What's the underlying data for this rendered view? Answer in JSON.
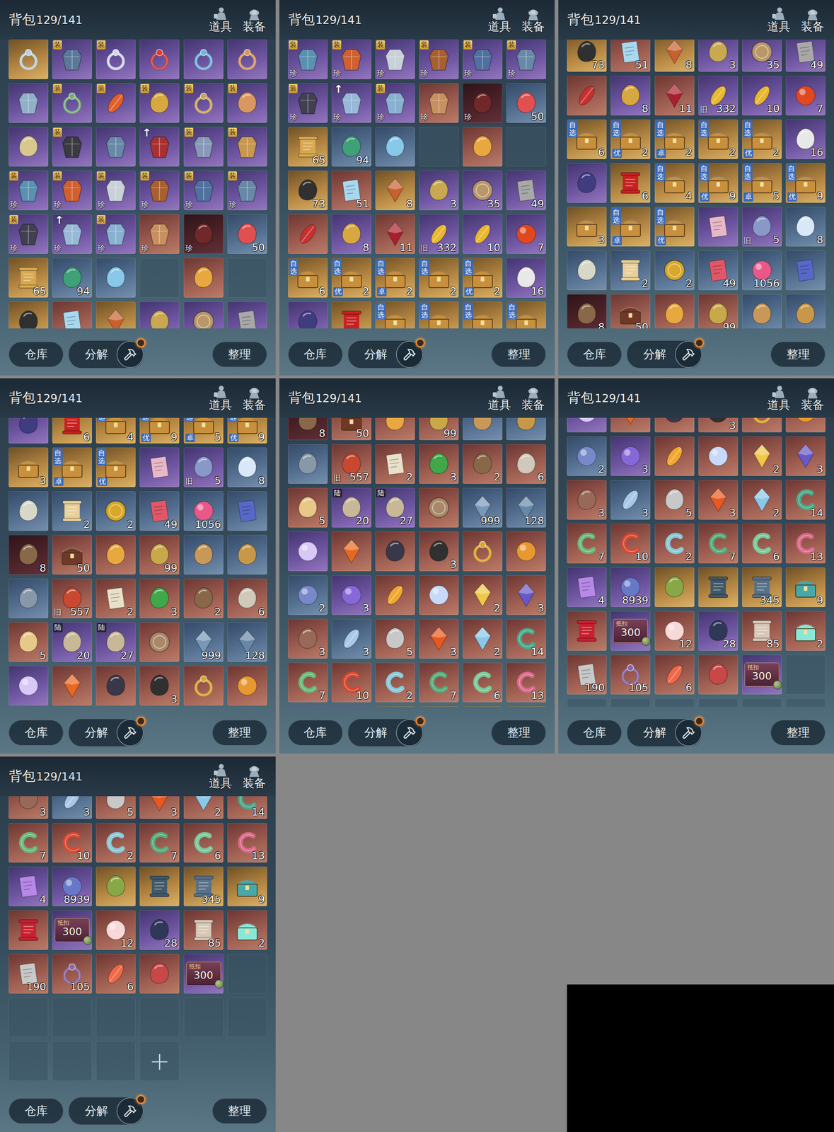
{
  "inventory": {
    "title": "背包",
    "count": "129/141",
    "tabs": [
      {
        "label": "道具"
      },
      {
        "label": "装备"
      }
    ],
    "buttons": [
      {
        "label": "仓库",
        "kind": "plain",
        "alert": false
      },
      {
        "label": "分解",
        "kind": "tool",
        "alert": true
      },
      {
        "label": "整理",
        "kind": "plain",
        "alert": false
      }
    ],
    "badge_kinds": {
      "装": "gold",
      "自选": "stack",
      "陆": "dark",
      "↑": "arrow",
      "抵扣": "note",
      "珍": "plain",
      "旧": "plain",
      "优": "blue",
      "卓": "blue"
    },
    "rows": [
      [
        {
          "kind": "ring",
          "rarity": "gold",
          "color": "#b8d0e0"
        },
        {
          "kind": "gear",
          "rarity": "purple",
          "color": "#5a7898",
          "mark": "装"
        },
        {
          "kind": "ring",
          "rarity": "purple",
          "color": "#d0d8e8",
          "mark": "装"
        },
        {
          "kind": "ring",
          "rarity": "purple",
          "color": "#d04038"
        },
        {
          "kind": "ring",
          "rarity": "purple",
          "color": "#70b8d8"
        },
        {
          "kind": "ring",
          "rarity": "purple",
          "color": "#d89858"
        }
      ],
      [
        {
          "kind": "gear",
          "rarity": "purple",
          "color": "#90b0c8"
        },
        {
          "kind": "ring",
          "rarity": "purple",
          "color": "#78b078",
          "mark": "装"
        },
        {
          "kind": "leaf",
          "rarity": "purple",
          "color": "#e06028",
          "mark": "装"
        },
        {
          "kind": "misc",
          "rarity": "purple",
          "color": "#d8a840",
          "mark": "装"
        },
        {
          "kind": "ring",
          "rarity": "purple",
          "color": "#c8a860",
          "mark": "装"
        },
        {
          "kind": "misc",
          "rarity": "purple",
          "color": "#d89860",
          "mark": "装"
        }
      ],
      [
        {
          "kind": "misc",
          "rarity": "purple",
          "color": "#d8c890"
        },
        {
          "kind": "gear",
          "rarity": "purple",
          "color": "#3a3a40",
          "mark": "装"
        },
        {
          "kind": "gear",
          "rarity": "purple",
          "color": "#6888a8"
        },
        {
          "kind": "gear",
          "rarity": "purple",
          "color": "#a83030",
          "mark": "↑"
        },
        {
          "kind": "gear",
          "rarity": "purple",
          "color": "#8898b8",
          "mark": "装"
        },
        {
          "kind": "gear",
          "rarity": "purple",
          "color": "#c89850",
          "mark": "装"
        }
      ],
      [
        {
          "kind": "gear",
          "rarity": "purple",
          "color": "#5a90b0",
          "mark": "装",
          "sub": "珍"
        },
        {
          "kind": "gear",
          "rarity": "purple",
          "color": "#d06030",
          "mark": "装",
          "sub": "珍"
        },
        {
          "kind": "gear",
          "rarity": "purple",
          "color": "#c8d0d8",
          "mark": "装",
          "sub": "珍"
        },
        {
          "kind": "gear",
          "rarity": "purple",
          "color": "#a86030",
          "mark": "装",
          "sub": "珍"
        },
        {
          "kind": "gear",
          "rarity": "purple",
          "color": "#5070a0",
          "mark": "装",
          "sub": "珍"
        },
        {
          "kind": "gear",
          "rarity": "purple",
          "color": "#6888a8",
          "mark": "装",
          "sub": "珍"
        }
      ],
      [
        {
          "kind": "gear",
          "rarity": "purple",
          "color": "#404050",
          "mark": "装",
          "sub": "珍"
        },
        {
          "kind": "gear",
          "rarity": "purple",
          "color": "#98b8d8",
          "mark": "↑",
          "sub": "珍"
        },
        {
          "kind": "gear",
          "rarity": "purple",
          "color": "#88b0d0",
          "mark": "装",
          "sub": "珍"
        },
        {
          "kind": "gear",
          "rarity": "red",
          "color": "#c89060",
          "sub": "珍"
        },
        {
          "kind": "misc",
          "rarity": "dark",
          "color": "#702828",
          "sub": "珍"
        },
        {
          "kind": "misc",
          "rarity": "blue",
          "color": "#e05050",
          "count": "50"
        }
      ],
      [
        {
          "kind": "scroll",
          "rarity": "gold",
          "color": "#d8a850",
          "count": "65"
        },
        {
          "kind": "misc",
          "rarity": "blue",
          "color": "#40a078",
          "count": "94"
        },
        {
          "kind": "misc",
          "rarity": "blue",
          "color": "#88c8e8"
        },
        {
          "kind": "empty"
        },
        {
          "kind": "misc",
          "rarity": "red",
          "color": "#e8a840"
        },
        {
          "kind": "empty"
        }
      ],
      [
        {
          "kind": "misc",
          "rarity": "gold",
          "color": "#303030",
          "count": "73"
        },
        {
          "kind": "paper",
          "rarity": "red",
          "color": "#a8d8f0",
          "count": "51"
        },
        {
          "kind": "crystal",
          "rarity": "gold",
          "color": "#c86030",
          "count": "8"
        },
        {
          "kind": "misc",
          "rarity": "purple",
          "color": "#c8a850",
          "count": "3"
        },
        {
          "kind": "coin",
          "rarity": "purple",
          "color": "#b89868",
          "count": "35"
        },
        {
          "kind": "paper",
          "rarity": "purple",
          "color": "#a8a8a8",
          "count": "49"
        }
      ],
      [
        {
          "kind": "leaf",
          "rarity": "red",
          "color": "#c83030"
        },
        {
          "kind": "misc",
          "rarity": "purple",
          "color": "#d8a840",
          "count": "8"
        },
        {
          "kind": "crystal",
          "rarity": "red",
          "color": "#a82030",
          "count": "11"
        },
        {
          "kind": "leaf",
          "rarity": "purple",
          "color": "#e8b830",
          "count": "332",
          "sub": "旧"
        },
        {
          "kind": "leaf",
          "rarity": "purple",
          "color": "#e8b830",
          "count": "10"
        },
        {
          "kind": "orb",
          "rarity": "purple",
          "color": "#e04820",
          "count": "7"
        }
      ],
      [
        {
          "kind": "chest",
          "rarity": "gold",
          "color": "#c8903c",
          "count": "6",
          "mark": "自选"
        },
        {
          "kind": "chest",
          "rarity": "gold",
          "color": "#c8903c",
          "count": "2",
          "mark": "自选",
          "sub": "优"
        },
        {
          "kind": "chest",
          "rarity": "gold",
          "color": "#c8903c",
          "count": "2",
          "mark": "自选",
          "sub": "卓"
        },
        {
          "kind": "chest",
          "rarity": "gold",
          "color": "#c8903c",
          "count": "2",
          "mark": "自选"
        },
        {
          "kind": "chest",
          "rarity": "gold",
          "color": "#c8903c",
          "count": "2",
          "mark": "自选",
          "sub": "优"
        },
        {
          "kind": "misc",
          "rarity": "purple",
          "color": "#e8e8e8",
          "count": "16"
        }
      ],
      [
        {
          "kind": "misc",
          "rarity": "purple",
          "color": "#403c80"
        },
        {
          "kind": "scroll",
          "rarity": "gold",
          "color": "#c82020",
          "count": "6"
        },
        {
          "kind": "chest",
          "rarity": "gold",
          "color": "#c8903c",
          "count": "4",
          "mark": "自选"
        },
        {
          "kind": "chest",
          "rarity": "gold",
          "color": "#c8903c",
          "count": "9",
          "mark": "自选",
          "sub": "优"
        },
        {
          "kind": "chest",
          "rarity": "gold",
          "color": "#c8903c",
          "count": "5",
          "mark": "自选",
          "sub": "卓"
        },
        {
          "kind": "chest",
          "rarity": "gold",
          "color": "#c8903c",
          "count": "9",
          "mark": "自选",
          "sub": "优"
        }
      ],
      [
        {
          "kind": "chest",
          "rarity": "gold",
          "color": "#c8903c",
          "count": "3"
        },
        {
          "kind": "chest",
          "rarity": "gold",
          "color": "#c8903c",
          "mark": "自选",
          "sub": "卓"
        },
        {
          "kind": "chest",
          "rarity": "gold",
          "color": "#c8903c",
          "mark": "自选",
          "sub": "优"
        },
        {
          "kind": "paper",
          "rarity": "purple",
          "color": "#e8b8c8"
        },
        {
          "kind": "misc",
          "rarity": "purple",
          "color": "#8898c8",
          "count": "5",
          "sub": "旧"
        },
        {
          "kind": "misc",
          "rarity": "blue",
          "color": "#d8e8f8",
          "count": "8"
        }
      ],
      [
        {
          "kind": "misc",
          "rarity": "blue",
          "color": "#d8d8c8"
        },
        {
          "kind": "scroll",
          "rarity": "blue",
          "color": "#e8d098",
          "count": "2"
        },
        {
          "kind": "coin",
          "rarity": "blue",
          "color": "#d8a828",
          "count": "2"
        },
        {
          "kind": "paper",
          "rarity": "blue",
          "color": "#e05868",
          "count": "49"
        },
        {
          "kind": "orb",
          "rarity": "blue",
          "color": "#e85888",
          "count": "1056"
        },
        {
          "kind": "paper",
          "rarity": "blue",
          "color": "#5868c8"
        }
      ],
      [
        {
          "kind": "misc",
          "rarity": "dark",
          "color": "#886848",
          "count": "8"
        },
        {
          "kind": "chest",
          "rarity": "red",
          "color": "#703828",
          "count": "50"
        },
        {
          "kind": "misc",
          "rarity": "red",
          "color": "#e8a840"
        },
        {
          "kind": "misc",
          "rarity": "red",
          "color": "#c8a848",
          "count": "99"
        },
        {
          "kind": "misc",
          "rarity": "blue",
          "color": "#c89858"
        },
        {
          "kind": "misc",
          "rarity": "blue",
          "color": "#c89848"
        }
      ],
      [
        {
          "kind": "misc",
          "rarity": "blue",
          "color": "#8898a8"
        },
        {
          "kind": "misc",
          "rarity": "red",
          "color": "#c84830",
          "count": "557",
          "sub": "旧"
        },
        {
          "kind": "paper",
          "rarity": "red",
          "color": "#e8e0c8",
          "count": "2"
        },
        {
          "kind": "misc",
          "rarity": "red",
          "color": "#40a848",
          "count": "3"
        },
        {
          "kind": "misc",
          "rarity": "red",
          "color": "#886848",
          "count": "2"
        },
        {
          "kind": "misc",
          "rarity": "red",
          "color": "#d0c8b8",
          "count": "6"
        }
      ],
      [
        {
          "kind": "misc",
          "rarity": "red",
          "color": "#e8c888",
          "count": "5"
        },
        {
          "kind": "misc",
          "rarity": "purple",
          "color": "#c8b898",
          "count": "20",
          "mark": "陆"
        },
        {
          "kind": "misc",
          "rarity": "purple",
          "color": "#c8b898",
          "count": "27",
          "mark": "陆"
        },
        {
          "kind": "coin",
          "rarity": "red",
          "color": "#a88868"
        },
        {
          "kind": "crystal",
          "rarity": "blue",
          "color": "#7898b8",
          "count": "999"
        },
        {
          "kind": "crystal",
          "rarity": "blue",
          "color": "#6888a8",
          "count": "128"
        }
      ],
      [
        {
          "kind": "orb",
          "rarity": "purple",
          "color": "#d8c8f8"
        },
        {
          "kind": "crystal",
          "rarity": "red",
          "color": "#e86820"
        },
        {
          "kind": "misc",
          "rarity": "red",
          "color": "#383848"
        },
        {
          "kind": "misc",
          "rarity": "red",
          "color": "#303030",
          "count": "3"
        },
        {
          "kind": "ring",
          "rarity": "red",
          "color": "#d8a830"
        },
        {
          "kind": "orb",
          "rarity": "red",
          "color": "#e89830"
        }
      ],
      [
        {
          "kind": "orb",
          "rarity": "blue",
          "color": "#7888c8",
          "count": "2"
        },
        {
          "kind": "orb",
          "rarity": "purple",
          "color": "#8868d8",
          "count": "3"
        },
        {
          "kind": "leaf",
          "rarity": "red",
          "color": "#f0a830"
        },
        {
          "kind": "orb",
          "rarity": "red",
          "color": "#c8d8f8"
        },
        {
          "kind": "crystal",
          "rarity": "red",
          "color": "#f0c848",
          "count": "2"
        },
        {
          "kind": "crystal",
          "rarity": "red",
          "color": "#6858c8",
          "count": "3"
        }
      ],
      [
        {
          "kind": "misc",
          "rarity": "red",
          "color": "#986858",
          "count": "3"
        },
        {
          "kind": "leaf",
          "rarity": "blue",
          "color": "#a8c8e8",
          "count": "3"
        },
        {
          "kind": "misc",
          "rarity": "red",
          "color": "#c8c8c8",
          "count": "5"
        },
        {
          "kind": "crystal",
          "rarity": "red",
          "color": "#e85820",
          "count": "3"
        },
        {
          "kind": "crystal",
          "rarity": "red",
          "color": "#88c8e8",
          "count": "2"
        },
        {
          "kind": "jade",
          "rarity": "red",
          "color": "#48a888",
          "count": "14"
        }
      ],
      [
        {
          "kind": "jade",
          "rarity": "red",
          "color": "#68b878",
          "count": "7"
        },
        {
          "kind": "jade",
          "rarity": "red",
          "color": "#d84830",
          "count": "10"
        },
        {
          "kind": "jade",
          "rarity": "red",
          "color": "#88c8d8",
          "count": "2"
        },
        {
          "kind": "jade",
          "rarity": "red",
          "color": "#58a878",
          "count": "7"
        },
        {
          "kind": "jade",
          "rarity": "red",
          "color": "#78c898",
          "count": "6"
        },
        {
          "kind": "jade",
          "rarity": "red",
          "color": "#d86888",
          "count": "13"
        }
      ],
      [
        {
          "kind": "paper",
          "rarity": "purple",
          "color": "#b888e8",
          "count": "4"
        },
        {
          "kind": "orb",
          "rarity": "purple",
          "color": "#6878c8",
          "count": "8939"
        },
        {
          "kind": "misc",
          "rarity": "gold",
          "color": "#88a848"
        },
        {
          "kind": "scroll",
          "rarity": "gold",
          "color": "#405868"
        },
        {
          "kind": "scroll",
          "rarity": "gold",
          "color": "#587088",
          "count": "345"
        },
        {
          "kind": "chest",
          "rarity": "gold",
          "color": "#48a8a8",
          "count": "9"
        }
      ],
      [
        {
          "kind": "scroll",
          "rarity": "red",
          "color": "#c82030"
        },
        {
          "kind": "ticket",
          "rarity": "purple",
          "color": "#7a4058",
          "mark": "抵扣",
          "count": "300"
        },
        {
          "kind": "orb",
          "rarity": "red",
          "color": "#f8d8d8",
          "count": "12"
        },
        {
          "kind": "misc",
          "rarity": "purple",
          "color": "#303858",
          "count": "28"
        },
        {
          "kind": "scroll",
          "rarity": "red",
          "color": "#d8c8b8",
          "count": "85"
        },
        {
          "kind": "chest",
          "rarity": "red",
          "color": "#88e8d8",
          "count": "2"
        }
      ],
      [
        {
          "kind": "paper",
          "rarity": "red",
          "color": "#c8c8c8",
          "count": "190"
        },
        {
          "kind": "ring",
          "rarity": "red",
          "color": "#8868a8",
          "count": "105"
        },
        {
          "kind": "leaf",
          "rarity": "red",
          "color": "#f06848",
          "count": "6"
        },
        {
          "kind": "misc",
          "rarity": "red",
          "color": "#c84848"
        },
        {
          "kind": "ticket",
          "rarity": "purple",
          "color": "#7a4058",
          "mark": "抵扣",
          "count": "300"
        },
        {
          "kind": "empty"
        }
      ],
      [
        {
          "kind": "empty"
        },
        {
          "kind": "empty"
        },
        {
          "kind": "empty"
        },
        {
          "kind": "empty"
        },
        {
          "kind": "empty"
        },
        {
          "kind": "empty"
        }
      ],
      [
        {
          "kind": "empty"
        },
        {
          "kind": "empty"
        },
        {
          "kind": "empty"
        },
        {
          "kind": "add",
          "label": "+"
        }
      ]
    ]
  },
  "panels": [
    {
      "scroll_rows": 0
    },
    {
      "scroll_rows": 3
    },
    {
      "scroll_rows": 6.17
    },
    {
      "scroll_rows": 9.32
    },
    {
      "scroll_rows": 12.4
    },
    {
      "scroll_rows": 15.58
    },
    {
      "scroll_rows": 17.39
    }
  ]
}
